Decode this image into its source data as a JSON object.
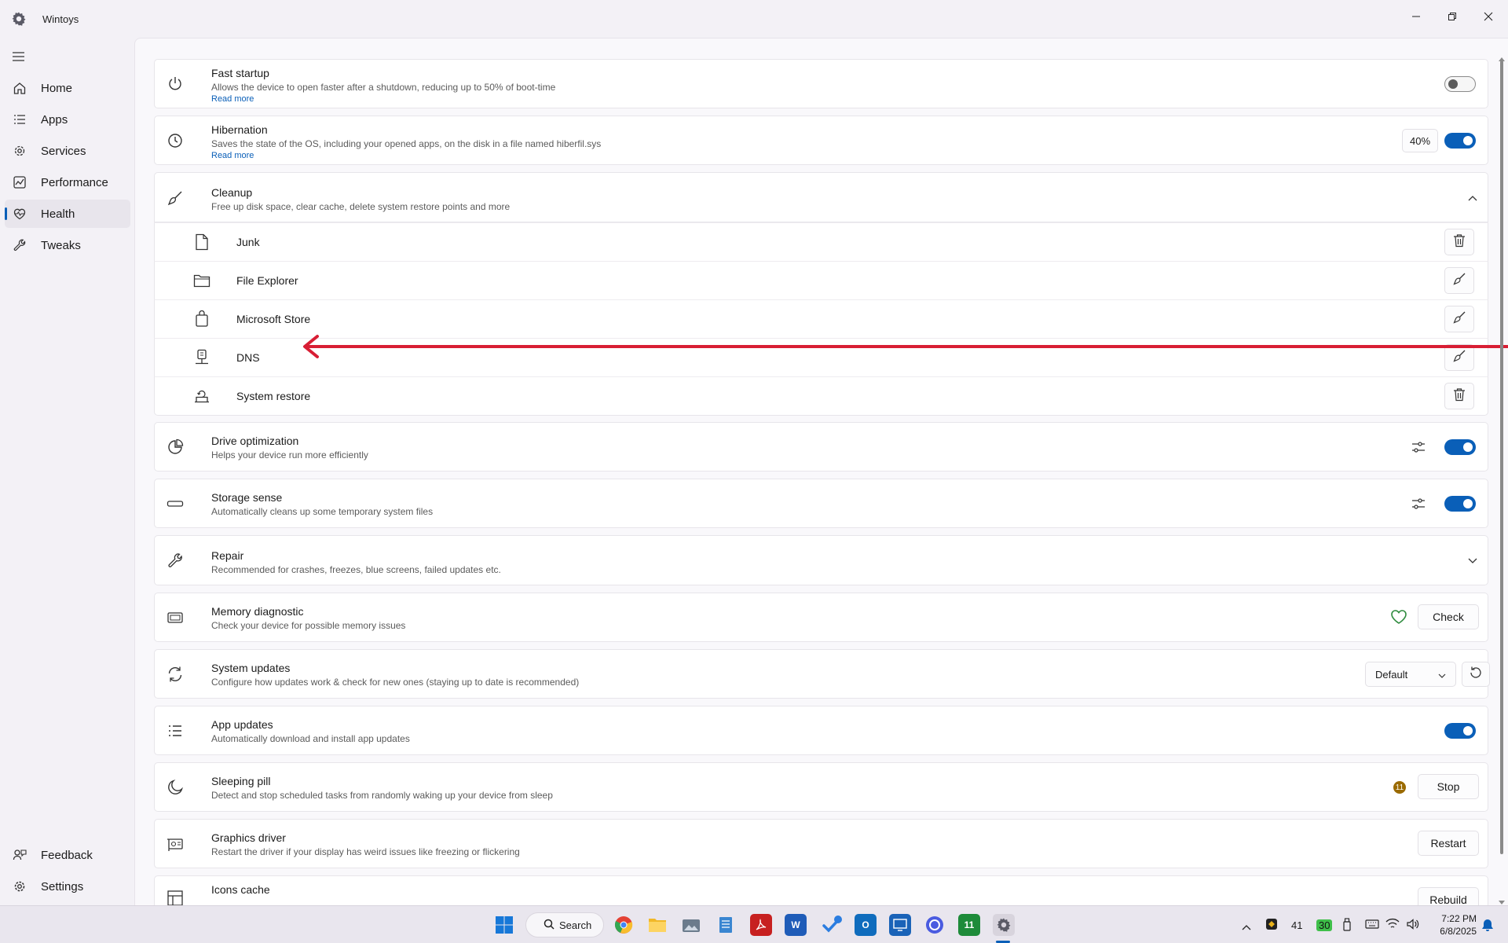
{
  "app": {
    "title": "Wintoys"
  },
  "sidebar": {
    "items": [
      {
        "label": "Home",
        "icon": "home-icon"
      },
      {
        "label": "Apps",
        "icon": "apps-list-icon"
      },
      {
        "label": "Services",
        "icon": "services-gear-icon"
      },
      {
        "label": "Performance",
        "icon": "performance-chart-icon"
      },
      {
        "label": "Health",
        "icon": "health-heart-icon",
        "active": true
      },
      {
        "label": "Tweaks",
        "icon": "wrench-icon"
      }
    ],
    "footer": [
      {
        "label": "Feedback",
        "icon": "feedback-icon"
      },
      {
        "label": "Settings",
        "icon": "settings-gear-icon"
      }
    ]
  },
  "main": {
    "fast_startup": {
      "title": "Fast startup",
      "desc": "Allows the device to open faster after a shutdown, reducing up to 50% of boot-time",
      "link": "Read more",
      "toggle": false
    },
    "hibernation": {
      "title": "Hibernation",
      "desc": "Saves the state of the OS, including your opened apps, on the disk in a file named hiberfil.sys",
      "link": "Read more",
      "percent": "40%",
      "toggle": true
    },
    "cleanup": {
      "title": "Cleanup",
      "desc": "Free up disk space, clear cache, delete system restore points and more",
      "expanded": true,
      "items": [
        {
          "label": "Junk",
          "icon": "file-icon",
          "action": "trash-icon"
        },
        {
          "label": "File Explorer",
          "icon": "folder-icon",
          "action": "broom-icon"
        },
        {
          "label": "Microsoft Store",
          "icon": "store-bag-icon",
          "action": "broom-icon"
        },
        {
          "label": "DNS",
          "icon": "dns-icon",
          "action": "broom-icon"
        },
        {
          "label": "System restore",
          "icon": "system-restore-icon",
          "action": "trash-icon"
        }
      ]
    },
    "drive_optimization": {
      "title": "Drive optimization",
      "desc": "Helps your device run more efficiently",
      "toggle": true
    },
    "storage_sense": {
      "title": "Storage sense",
      "desc": "Automatically cleans up some temporary system files",
      "toggle": true
    },
    "repair": {
      "title": "Repair",
      "desc": "Recommended for crashes, freezes, blue screens, failed updates etc."
    },
    "memory_diagnostic": {
      "title": "Memory diagnostic",
      "desc": "Check your device for possible memory issues",
      "button": "Check"
    },
    "system_updates": {
      "title": "System updates",
      "desc": "Configure how updates work & check for new ones (staying up to date is recommended)",
      "select": "Default"
    },
    "app_updates": {
      "title": "App updates",
      "desc": "Automatically download and install app updates",
      "toggle": true
    },
    "sleeping_pill": {
      "title": "Sleeping pill",
      "desc": "Detect and stop scheduled tasks from randomly waking up your device from sleep",
      "badge": "11",
      "button": "Stop"
    },
    "graphics_driver": {
      "title": "Graphics driver",
      "desc": "Restart the driver if your display has weird issues like freezing or flickering",
      "button": "Restart"
    },
    "icons_cache": {
      "title": "Icons cache",
      "button": "Rebuild"
    }
  },
  "taskbar": {
    "search_label": "Search",
    "tray": {
      "count_a": "41",
      "count_b": "30"
    },
    "clock": {
      "time": "7:22 PM",
      "date": "6/8/2025"
    }
  },
  "colors": {
    "accent": "#0a5fb8",
    "annotation_arrow": "#d81e34",
    "health_heart": "#2e8b3e",
    "badge": "#9a6a00"
  }
}
